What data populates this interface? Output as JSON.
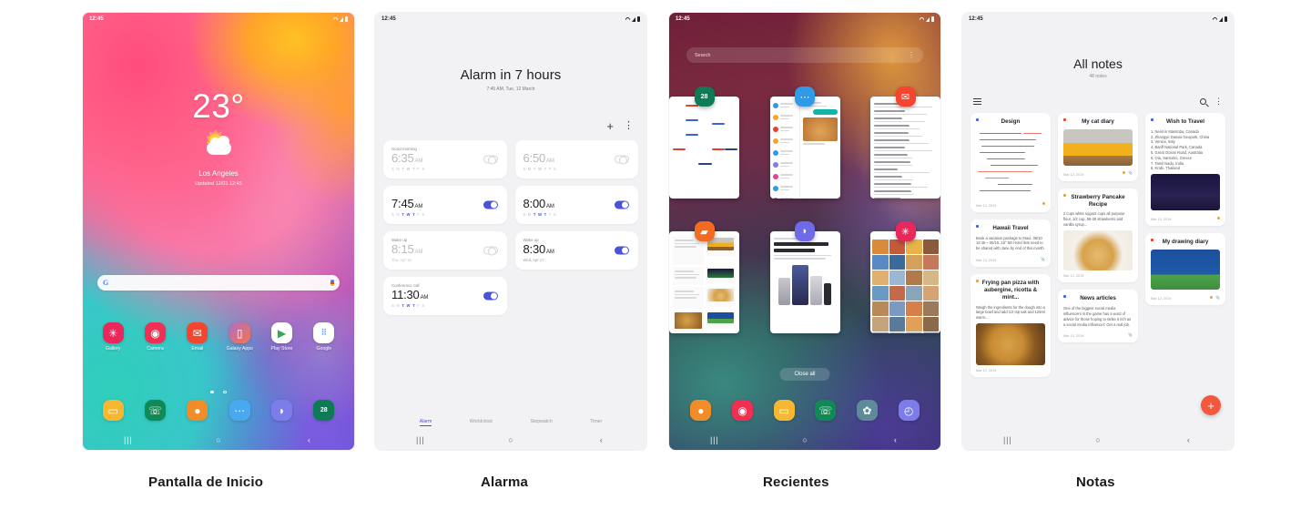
{
  "captions": [
    {
      "label": "Pantalla de Inicio"
    },
    {
      "label": "Alarma"
    },
    {
      "label": "Recientes"
    },
    {
      "label": "Notas"
    }
  ],
  "status_bar": {
    "clock": "12:45"
  },
  "home": {
    "weather": {
      "temperature": "23°",
      "degree_mark": "°",
      "city": "Los Angeles",
      "updated": "Updated 12/03 12:45"
    },
    "search": {
      "logo": "G",
      "placeholder": ""
    },
    "apps": [
      {
        "label": "Gallery",
        "glyph": "✳",
        "color": "#e8275a"
      },
      {
        "label": "Camera",
        "glyph": "◉",
        "color": "#f02f52"
      },
      {
        "label": "Email",
        "glyph": "✉",
        "color": "#f5452f"
      },
      {
        "label": "Galaxy Apps",
        "glyph": "▯",
        "color": "#f06a8a"
      },
      {
        "label": "Play Store",
        "glyph": "▶",
        "color": "#ffffff"
      },
      {
        "label": "Google",
        "glyph": "⠿",
        "color": "#ffffff"
      }
    ],
    "page_dots": {
      "active": 1,
      "total": 2
    },
    "dock": [
      {
        "name": "my-files",
        "glyph": "▭",
        "color": "#f7b733"
      },
      {
        "name": "phone",
        "glyph": "☏",
        "color": "#0f8a54"
      },
      {
        "name": "contacts",
        "glyph": "●",
        "color": "#f28c28"
      },
      {
        "name": "messages",
        "glyph": "⋯",
        "color": "#4aa8ef"
      },
      {
        "name": "internet",
        "glyph": "◗",
        "color": "#7d7ceb"
      },
      {
        "name": "calendar",
        "glyph": "28",
        "color": "#0f7a56"
      }
    ],
    "nav": {
      "recents": "|||",
      "home": "○",
      "back": "‹"
    }
  },
  "alarm": {
    "title": "Alarm in 7 hours",
    "subtitle": "7:45 AM, Tue, 12 March",
    "actions": {
      "add": "+",
      "more": "⋮"
    },
    "day_letters": [
      "S",
      "M",
      "T",
      "W",
      "T",
      "F",
      "S"
    ],
    "items": [
      {
        "label": "Good morning",
        "time": "6:35",
        "ampm": "AM",
        "days_active": [
          0,
          0,
          1,
          1,
          1,
          0,
          0
        ],
        "sub": "",
        "enabled": false
      },
      {
        "label": "",
        "time": "6:50",
        "ampm": "AM",
        "days_active": [
          0,
          0,
          1,
          1,
          1,
          0,
          0
        ],
        "sub": "",
        "enabled": false
      },
      {
        "label": "",
        "time": "7:45",
        "ampm": "AM",
        "days_active": [
          0,
          0,
          1,
          1,
          1,
          0,
          0
        ],
        "sub": "",
        "enabled": true
      },
      {
        "label": "",
        "time": "8:00",
        "ampm": "AM",
        "days_active": [
          0,
          0,
          1,
          1,
          1,
          0,
          0
        ],
        "sub": "",
        "enabled": true
      },
      {
        "label": "Wake up",
        "time": "8:15",
        "ampm": "AM",
        "days_active": [],
        "sub": "Thu, Apr 18",
        "enabled": false
      },
      {
        "label": "Wake up",
        "time": "8:30",
        "ampm": "AM",
        "days_active": [],
        "sub": "Wed, Apr 17",
        "enabled": true
      },
      {
        "label": "Conference call",
        "time": "11:30",
        "ampm": "AM",
        "days_active": [
          0,
          0,
          1,
          1,
          1,
          0,
          0
        ],
        "sub": "",
        "enabled": true
      }
    ],
    "tabs": [
      {
        "label": "Alarm",
        "active": true
      },
      {
        "label": "Worldclock",
        "active": false
      },
      {
        "label": "Stopwatch",
        "active": false
      },
      {
        "label": "Timer",
        "active": false
      }
    ],
    "nav": {
      "recents": "|||",
      "home": "○",
      "back": "‹"
    }
  },
  "recents": {
    "search_placeholder": "Search",
    "more": "⋮",
    "close_all": "Close all",
    "cards": [
      {
        "app": "calendar",
        "glyph": "28",
        "color": "#0f7a56"
      },
      {
        "app": "messages",
        "glyph": "⋯",
        "color": "#2f9ae8"
      },
      {
        "app": "email",
        "glyph": "✉",
        "color": "#f5452f"
      },
      {
        "app": "notes",
        "glyph": "▰",
        "color": "#f26b21"
      },
      {
        "app": "internet",
        "glyph": "◗",
        "color": "#6f6ae8"
      },
      {
        "app": "gallery",
        "glyph": "✳",
        "color": "#e8275a"
      }
    ],
    "dock": [
      {
        "name": "contacts",
        "glyph": "●",
        "color": "#f28c28"
      },
      {
        "name": "camera",
        "glyph": "◉",
        "color": "#f02f52"
      },
      {
        "name": "my-files",
        "glyph": "▭",
        "color": "#f7b733"
      },
      {
        "name": "phone",
        "glyph": "☏",
        "color": "#0f8a54"
      },
      {
        "name": "settings",
        "glyph": "✿",
        "color": "#5f8a99"
      },
      {
        "name": "clock",
        "glyph": "◴",
        "color": "#7d7ceb"
      }
    ],
    "nav": {
      "recents": "|||",
      "home": "○",
      "back": "‹"
    }
  },
  "notes": {
    "title": "All notes",
    "count": "48 notes",
    "fab": "+",
    "items": [
      {
        "title": "Design",
        "type": "handwriting",
        "date": "Mar 12, 2019",
        "cat_color": "#3a63d8",
        "mark_color": "#f0a227"
      },
      {
        "title": "Hawaii Travel",
        "type": "text",
        "body": "Book a vacation package to Maui. 06/10 13:45 ~ 06/15 ,15° 5D Hotel lists need to be shared with Jane by end of this month",
        "date": "Mar 12, 2019",
        "cat_color": "#3a63d8",
        "mark_color": ""
      },
      {
        "title": "Frying pan pizza with aubergine, ricotta & mint...",
        "type": "text-image",
        "body": "Weigh the ingredients for the dough into a large bowl and add 1/2 tsp salt and 125ml warm...",
        "date": "Mar 12, 2019",
        "cat_color": "#f0a227",
        "mark_color": ""
      },
      {
        "title": "My cat diary",
        "type": "image",
        "date": "Mar 12, 2019",
        "cat_color": "#e8402f",
        "mark_color": "#f0a227"
      },
      {
        "title": "Strawberry Pancake Recipe",
        "type": "text-image",
        "body": "2 cups white sugar2 cups all purpose flour, 1/2 cup, 55-30 strawberris and vanilla syrup...",
        "date": "Mar 12, 2019",
        "cat_color": "#f0a227",
        "mark_color": ""
      },
      {
        "title": "News articles",
        "type": "text",
        "body": "One of the biggest social media influencers in the game has a word of advice for those hoping to strike it rich as a social media influencer: Get a real job.",
        "date": "Mar 12, 2019",
        "cat_color": "#3a63d8",
        "mark_color": ""
      },
      {
        "title": "Wish to Travel",
        "type": "list-image",
        "list": [
          "1. Neist in Manitoba, Canada",
          "2. Zhangye Danxia Geopark, China",
          "3. Venice, Italy",
          "4. Banff National Park, Canada",
          "5. Great Ocean Road, Australia",
          "6. Oia, Santorini, Greece",
          "7. Tamil Nadu, India",
          "8. Krabi, Thailand"
        ],
        "date": "Mar 12, 2019",
        "cat_color": "#3a63d8",
        "mark_color": "#f0a227"
      },
      {
        "title": "My drawing diary",
        "type": "image",
        "date": "Mar 12, 2019",
        "cat_color": "#e8402f",
        "mark_color": "#f0a227"
      }
    ],
    "nav": {
      "recents": "|||",
      "home": "○",
      "back": "‹"
    }
  }
}
